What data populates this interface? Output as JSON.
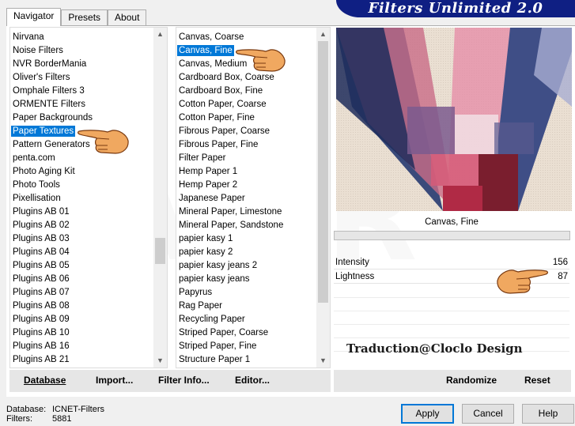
{
  "tabs": [
    {
      "label": "Navigator"
    },
    {
      "label": "Presets"
    },
    {
      "label": "About"
    }
  ],
  "banner": "Filters Unlimited 2.0",
  "categories": {
    "items": [
      "Nirvana",
      "Noise Filters",
      "NVR BorderMania",
      "Oliver's Filters",
      "Omphale Filters 3",
      "ORMENTE Filters",
      "Paper Backgrounds",
      "Paper Textures",
      "Pattern Generators",
      "penta.com",
      "Photo Aging Kit",
      "Photo Tools",
      "Pixellisation",
      "Plugins AB 01",
      "Plugins AB 02",
      "Plugins AB 03",
      "Plugins AB 04",
      "Plugins AB 05",
      "Plugins AB 06",
      "Plugins AB 07",
      "Plugins AB 08",
      "Plugins AB 09",
      "Plugins AB 10",
      "Plugins AB 16",
      "Plugins AB 21"
    ],
    "selected": "Paper Textures"
  },
  "filters": {
    "items": [
      "Canvas, Coarse",
      "Canvas, Fine",
      "Canvas, Medium",
      "Cardboard Box, Coarse",
      "Cardboard Box, Fine",
      "Cotton Paper, Coarse",
      "Cotton Paper, Fine",
      "Fibrous Paper, Coarse",
      "Fibrous Paper, Fine",
      "Filter Paper",
      "Hemp Paper 1",
      "Hemp Paper 2",
      "Japanese Paper",
      "Mineral Paper, Limestone",
      "Mineral Paper, Sandstone",
      "papier kasy 1",
      "papier kasy 2",
      "papier kasy jeans 2",
      "papier kasy jeans",
      "Papyrus",
      "Rag Paper",
      "Recycling Paper",
      "Striped Paper, Coarse",
      "Striped Paper, Fine",
      "Structure Paper 1"
    ],
    "selected": "Canvas, Fine"
  },
  "preview": {
    "filter_name": "Canvas, Fine"
  },
  "sliders": [
    {
      "label": "Intensity",
      "value": "156"
    },
    {
      "label": "Lightness",
      "value": "87"
    }
  ],
  "credit": "Traduction@Cloclo Design",
  "left_toolbar": {
    "database": "Database",
    "import": "Import...",
    "filter_info": "Filter Info...",
    "editor": "Editor..."
  },
  "right_toolbar": {
    "randomize": "Randomize",
    "reset": "Reset"
  },
  "status": {
    "database_label": "Database:",
    "database_value": "ICNET-Filters",
    "filters_label": "Filters:",
    "filters_value": "5881"
  },
  "buttons": {
    "apply": "Apply",
    "cancel": "Cancel",
    "help": "Help"
  },
  "colors": {
    "selection": "#0078d7",
    "banner": "#0f1f83"
  }
}
